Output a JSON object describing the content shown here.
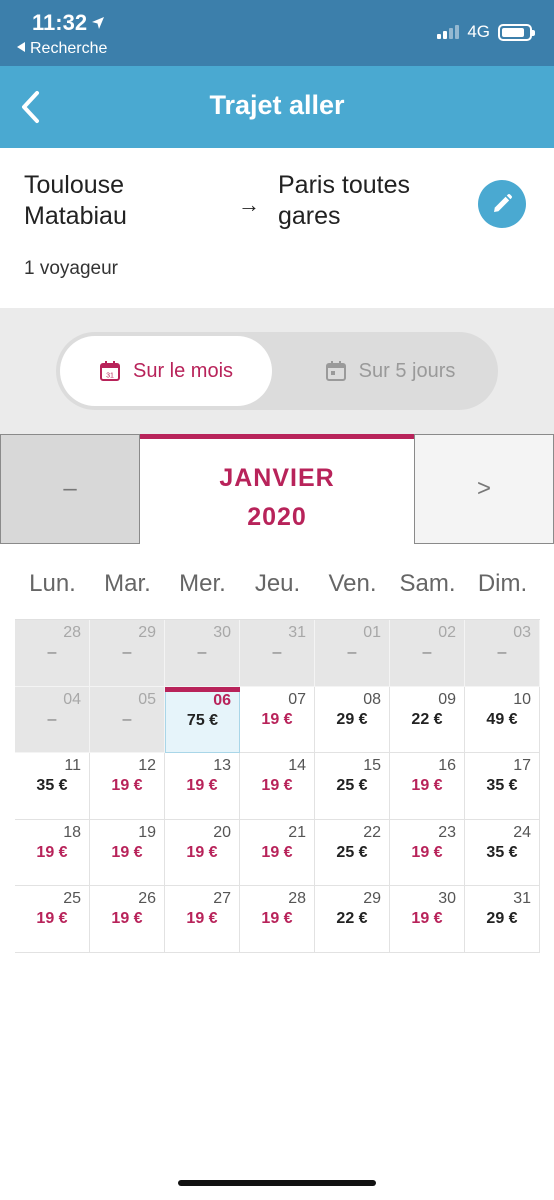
{
  "status_bar": {
    "time": "11:32",
    "back_label": "Recherche",
    "network": "4G"
  },
  "header": {
    "title": "Trajet aller"
  },
  "route": {
    "origin": "Toulouse Matabiau",
    "arrow": "→",
    "destination": "Paris toutes gares",
    "travelers": "1 voyageur"
  },
  "view_toggle": {
    "active": {
      "label": "Sur le mois",
      "icon": "calendar-month-icon",
      "icon_text": "31"
    },
    "inactive": {
      "label": "Sur 5 jours",
      "icon": "calendar-days-icon"
    }
  },
  "month_nav": {
    "prev_label": "–",
    "month": "JANVIER",
    "year": "2020",
    "next_label": ">"
  },
  "weekdays": [
    "Lun.",
    "Mar.",
    "Mer.",
    "Jeu.",
    "Ven.",
    "Sam.",
    "Dim."
  ],
  "colors": {
    "accent": "#b8235a",
    "header": "#4aa9d1",
    "status_bar": "#3c7fab"
  },
  "calendar": [
    {
      "day": "28",
      "price": "–",
      "state": "disabled"
    },
    {
      "day": "29",
      "price": "–",
      "state": "disabled"
    },
    {
      "day": "30",
      "price": "–",
      "state": "disabled"
    },
    {
      "day": "31",
      "price": "–",
      "state": "disabled"
    },
    {
      "day": "01",
      "price": "–",
      "state": "disabled"
    },
    {
      "day": "02",
      "price": "–",
      "state": "disabled"
    },
    {
      "day": "03",
      "price": "–",
      "state": "disabled"
    },
    {
      "day": "04",
      "price": "–",
      "state": "disabled"
    },
    {
      "day": "05",
      "price": "–",
      "state": "disabled"
    },
    {
      "day": "06",
      "price": "75 €",
      "state": "selected"
    },
    {
      "day": "07",
      "price": "19 €",
      "state": "low"
    },
    {
      "day": "08",
      "price": "29 €",
      "state": "normal"
    },
    {
      "day": "09",
      "price": "22 €",
      "state": "normal"
    },
    {
      "day": "10",
      "price": "49 €",
      "state": "normal"
    },
    {
      "day": "11",
      "price": "35 €",
      "state": "normal"
    },
    {
      "day": "12",
      "price": "19 €",
      "state": "low"
    },
    {
      "day": "13",
      "price": "19 €",
      "state": "low"
    },
    {
      "day": "14",
      "price": "19 €",
      "state": "low"
    },
    {
      "day": "15",
      "price": "25 €",
      "state": "normal"
    },
    {
      "day": "16",
      "price": "19 €",
      "state": "low"
    },
    {
      "day": "17",
      "price": "35 €",
      "state": "normal"
    },
    {
      "day": "18",
      "price": "19 €",
      "state": "low"
    },
    {
      "day": "19",
      "price": "19 €",
      "state": "low"
    },
    {
      "day": "20",
      "price": "19 €",
      "state": "low"
    },
    {
      "day": "21",
      "price": "19 €",
      "state": "low"
    },
    {
      "day": "22",
      "price": "25 €",
      "state": "normal"
    },
    {
      "day": "23",
      "price": "19 €",
      "state": "low"
    },
    {
      "day": "24",
      "price": "35 €",
      "state": "normal"
    },
    {
      "day": "25",
      "price": "19 €",
      "state": "low"
    },
    {
      "day": "26",
      "price": "19 €",
      "state": "low"
    },
    {
      "day": "27",
      "price": "19 €",
      "state": "low"
    },
    {
      "day": "28",
      "price": "19 €",
      "state": "low"
    },
    {
      "day": "29",
      "price": "22 €",
      "state": "normal"
    },
    {
      "day": "30",
      "price": "19 €",
      "state": "low"
    },
    {
      "day": "31",
      "price": "29 €",
      "state": "normal"
    }
  ]
}
